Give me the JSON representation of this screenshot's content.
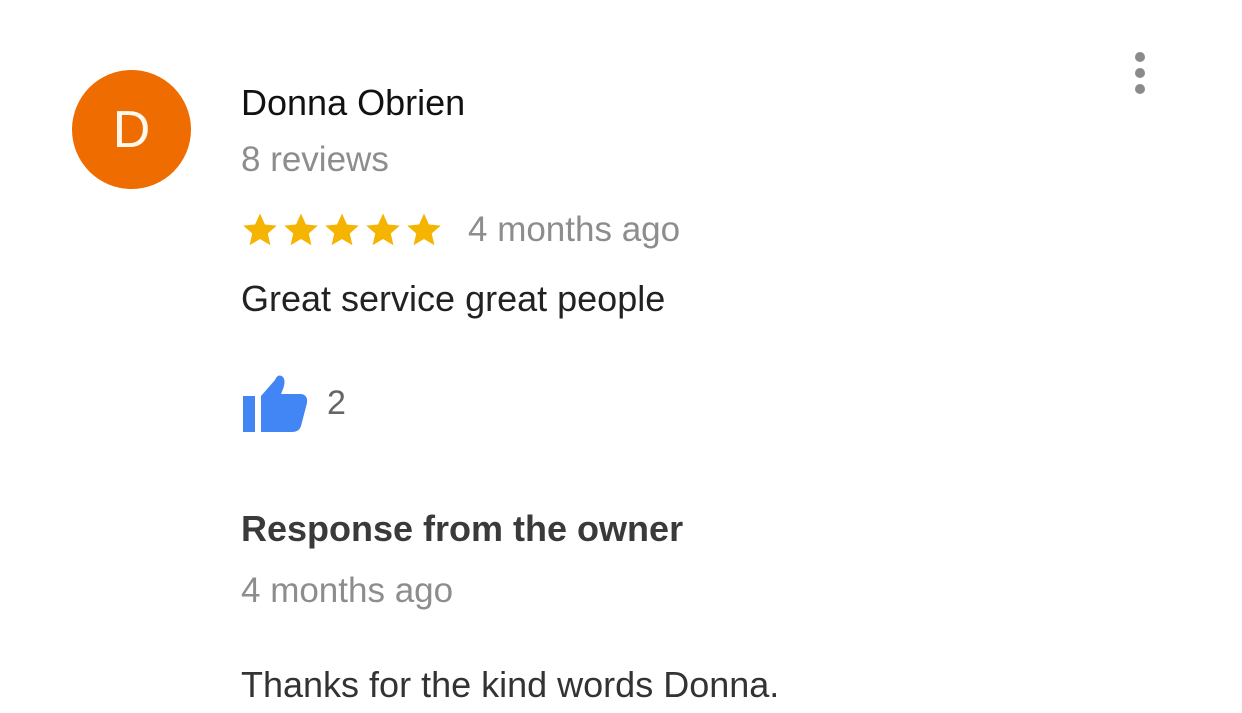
{
  "review": {
    "avatar_letter": "D",
    "avatar_color": "#ef6c00",
    "author": "Donna Obrien",
    "reviews_count": "8 reviews",
    "rating": 5,
    "rating_max": 5,
    "star_color": "#f4b400",
    "time": "4 months ago",
    "text": "Great service great people",
    "likes": "2",
    "like_icon": "thumbs-up-icon",
    "like_color": "#4285f4",
    "menu_icon": "more-vertical-icon"
  },
  "owner_response": {
    "title": "Response from the owner",
    "time": "4 months ago",
    "text": "Thanks for the kind words Donna."
  }
}
